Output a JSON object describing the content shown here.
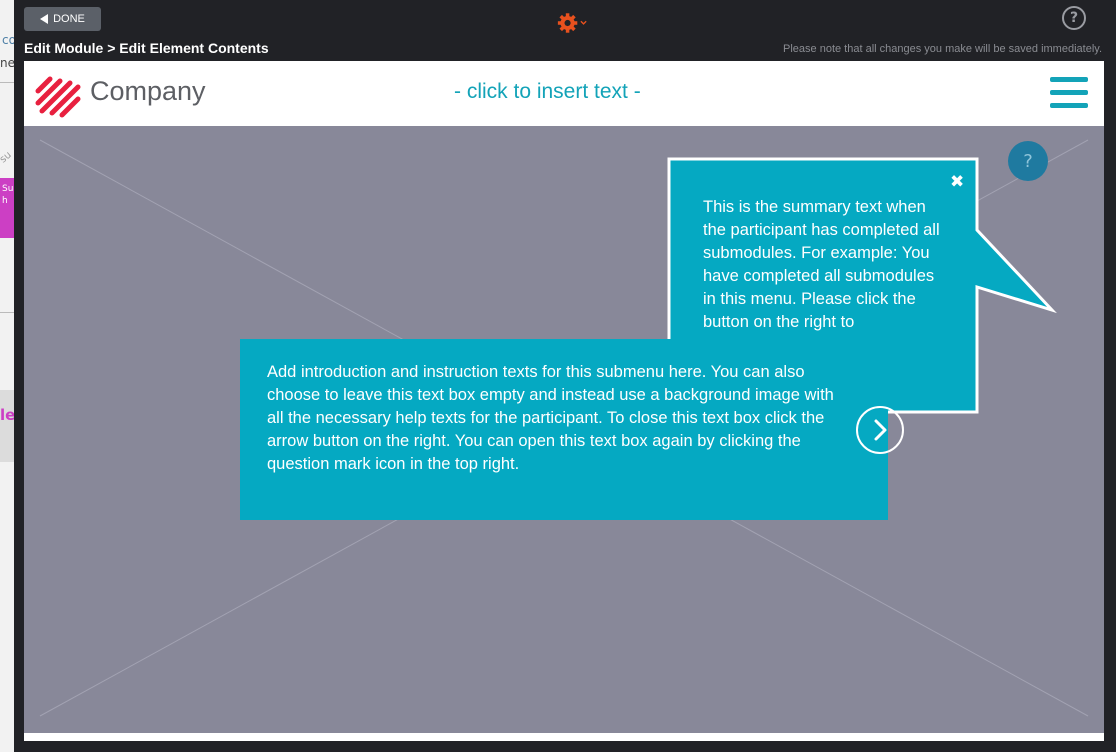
{
  "toolbar": {
    "done_label": "DONE",
    "settings_icon": "gear-icon",
    "help_icon": "question-circle-icon",
    "help_label": "?"
  },
  "breadcrumb": "Edit Module > Edit Element Contents",
  "notice": "Please note that all changes you make will be saved immediately.",
  "side_peek": {
    "t1": "co",
    "t2": "ne",
    "t3": "su",
    "pink": "Su h",
    "grey": "le"
  },
  "header": {
    "logo_text": "Company",
    "insert_placeholder": "- click to insert text -",
    "menu_icon": "hamburger-icon"
  },
  "canvas": {
    "help_label": "?",
    "summary_bubble": {
      "close_label": "✖",
      "text": "This is the summary text when the participant has completed all submodules. For example: You have completed all submodules in this menu. Please click the button on the right to"
    },
    "intro_box": {
      "text": "Add introduction and instruction texts for this submenu here. You can also choose to leave this text box empty and instead use a background image with all the necessary help texts for the participant. To close this text box click the arrow button on the right. You can open this text box again by clicking the question mark icon in the top right."
    }
  },
  "colors": {
    "accent": "#05a9c2",
    "brand_red": "#e8203f",
    "gear_orange": "#e8511e",
    "canvas_bg": "#888899",
    "dark_bg": "#212226"
  }
}
